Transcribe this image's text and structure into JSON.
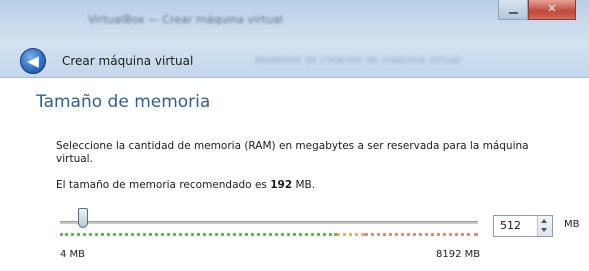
{
  "window": {
    "title": "VirtualBox — Crear máquina virtual",
    "close_glyph": "✕"
  },
  "nav": {
    "back_glyph": "◀",
    "title": "Crear máquina virtual",
    "hint": "Asistente de creación de máquina virtual"
  },
  "page": {
    "section_title": "Tamaño de memoria",
    "description": "Seleccione la cantidad de memoria (RAM) en megabytes a ser reservada para la máquina virtual.",
    "recommendation_prefix": "El tamaño de memoria recomendado es ",
    "recommendation_value": "192",
    "recommendation_suffix": " MB."
  },
  "memory": {
    "value": "512",
    "unit": "MB",
    "min_label": "4 MB",
    "max_label": "8192 MB",
    "value_mb": 512,
    "min_mb": 4,
    "max_mb": 8192
  },
  "colors": {
    "safe": "#5cbc4e",
    "warning": "#e9b062",
    "danger": "#e48878",
    "heading": "#2f5f93"
  }
}
